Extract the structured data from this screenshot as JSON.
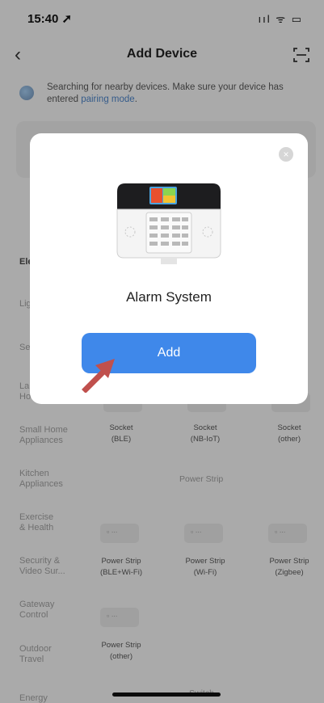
{
  "status_bar": {
    "time": "15:40 ➚",
    "icons": "ııl ᯤ ▭"
  },
  "header": {
    "back_glyph": "‹",
    "title": "Add Device"
  },
  "banner": {
    "text_before": "Searching for nearby devices. Make sure your device has entered ",
    "link": "pairing mode",
    "text_after": "."
  },
  "categories": [
    {
      "label": "Ele",
      "bold": true
    },
    {
      "label": "Lig"
    },
    {
      "label": "Se"
    },
    {
      "label": "La\nHo"
    },
    {
      "label": "Small Home\nAppliances"
    },
    {
      "label": "Kitchen\nAppliances"
    },
    {
      "label": "Exercise\n& Health"
    },
    {
      "label": "Security &\nVideo Sur..."
    },
    {
      "label": "Gateway\nControl"
    },
    {
      "label": "Outdoor\nTravel"
    },
    {
      "label": "Energy"
    }
  ],
  "products_row1": [
    {
      "label": "Socket\n(BLE)"
    },
    {
      "label": "Socket\n(NB-IoT)"
    },
    {
      "label": "Socket\n(other)"
    }
  ],
  "section_power_strip": "Power Strip",
  "products_row2": [
    {
      "label": "Power Strip\n(BLE+Wi-Fi)"
    },
    {
      "label": "Power Strip\n(Wi-Fi)"
    },
    {
      "label": "Power Strip\n(Zigbee)"
    }
  ],
  "products_row3": [
    {
      "label": "Power Strip\n(other)"
    }
  ],
  "section_partial": "Switch",
  "modal": {
    "close_glyph": "×",
    "device_name": "Alarm System",
    "add_label": "Add"
  },
  "colors": {
    "accent": "#3f88ea",
    "arrow": "#c0504d"
  }
}
